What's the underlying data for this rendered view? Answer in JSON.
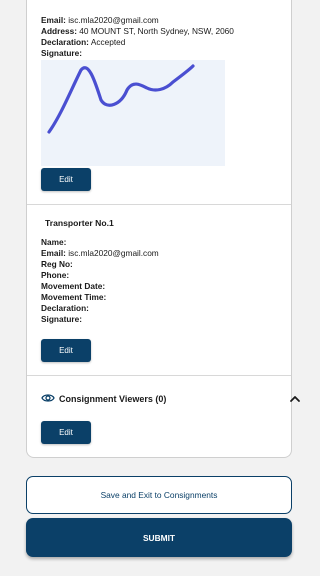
{
  "receiver": {
    "email_label": "Email:",
    "email_value": "isc.mla2020@gmail.com",
    "address_label": "Address:",
    "address_value": "40 MOUNT ST, North Sydney, NSW, 2060",
    "declaration_label": "Declaration:",
    "declaration_value": "Accepted",
    "signature_label": "Signature:",
    "edit_label": "Edit"
  },
  "transporter": {
    "title": "Transporter No.1",
    "name_label": "Name:",
    "email_label": "Email:",
    "email_value": "isc.mla2020@gmail.com",
    "reg_label": "Reg No:",
    "phone_label": "Phone:",
    "movement_date_label": "Movement Date:",
    "movement_time_label": "Movement Time:",
    "declaration_label": "Declaration:",
    "signature_label": "Signature:",
    "edit_label": "Edit"
  },
  "viewers": {
    "title": "Consignment Viewers (0)",
    "icon": "eye-icon",
    "toggle_icon": "chevron-up-icon",
    "edit_label": "Edit"
  },
  "actions": {
    "save_exit_label": "Save and Exit to Consignments",
    "submit_label": "SUBMIT"
  },
  "colors": {
    "primary": "#0b4068",
    "signature_stroke": "#4a4fd1",
    "signature_bg": "#eef3fa"
  }
}
